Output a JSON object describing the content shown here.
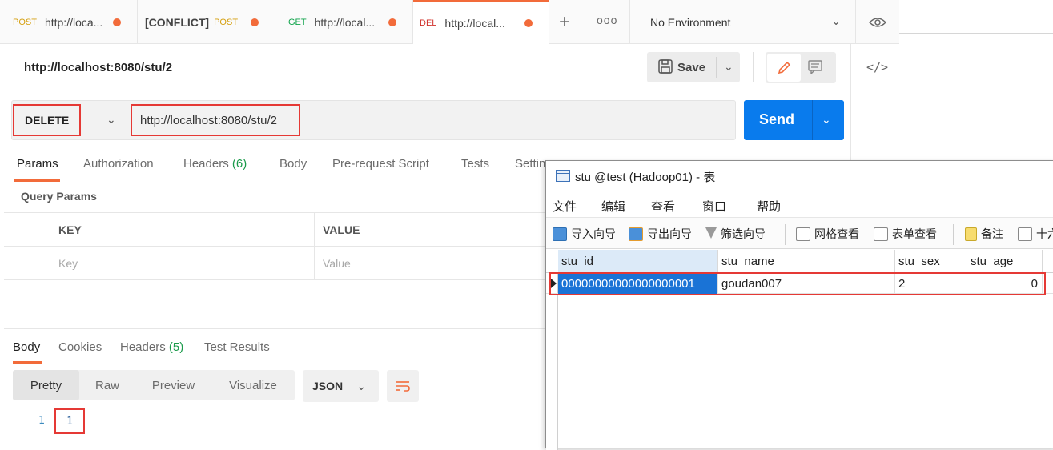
{
  "tabs": [
    {
      "method": "POST",
      "label": "http://loca...",
      "prefix": ""
    },
    {
      "method": "POST",
      "label": "",
      "prefix": "[CONFLICT]"
    },
    {
      "method": "GET",
      "label": "http://local...",
      "prefix": ""
    },
    {
      "method": "DEL",
      "label": "http://local...",
      "prefix": ""
    }
  ],
  "new_tab_label": "+",
  "more_tabs_label": "ooo",
  "environment": {
    "label": "No Environment"
  },
  "request": {
    "title": "http://localhost:8080/stu/2",
    "method": "DELETE",
    "url": "http://localhost:8080/stu/2"
  },
  "toolbar": {
    "save_label": "Save",
    "send_label": "Send"
  },
  "request_tabs": [
    {
      "label": "Params",
      "count": ""
    },
    {
      "label": "Authorization",
      "count": ""
    },
    {
      "label": "Headers",
      "count": "(6)"
    },
    {
      "label": "Body",
      "count": ""
    },
    {
      "label": "Pre-request Script",
      "count": ""
    },
    {
      "label": "Tests",
      "count": ""
    },
    {
      "label": "Settin",
      "count": ""
    }
  ],
  "query_params": {
    "title": "Query Params",
    "key_header": "KEY",
    "value_header": "VALUE",
    "key_placeholder": "Key",
    "value_placeholder": "Value"
  },
  "response_tabs": [
    {
      "label": "Body",
      "count": ""
    },
    {
      "label": "Cookies",
      "count": ""
    },
    {
      "label": "Headers",
      "count": "(5)"
    },
    {
      "label": "Test Results",
      "count": ""
    }
  ],
  "format_options": [
    "Pretty",
    "Raw",
    "Preview",
    "Visualize"
  ],
  "format_selected": "Pretty",
  "response_type": "JSON",
  "response_body": {
    "line_number": "1",
    "content": "1"
  },
  "navicat": {
    "title": "stu @test (Hadoop01) - 表",
    "menu": [
      "文件",
      "编辑",
      "查看",
      "窗口",
      "帮助"
    ],
    "toolbar": [
      "导入向导",
      "导出向导",
      "筛选向导",
      "网格查看",
      "表单查看",
      "备注",
      "十六"
    ],
    "columns": [
      "stu_id",
      "stu_name",
      "stu_sex",
      "stu_age"
    ],
    "rows": [
      {
        "stu_id": "00000000000000000001",
        "stu_name": "goudan007",
        "stu_sex": "2",
        "stu_age": "0"
      }
    ]
  },
  "colors": {
    "accent": "#f26b3a",
    "send": "#097bed",
    "highlight": "#e53935",
    "selection": "#1a73d6"
  }
}
